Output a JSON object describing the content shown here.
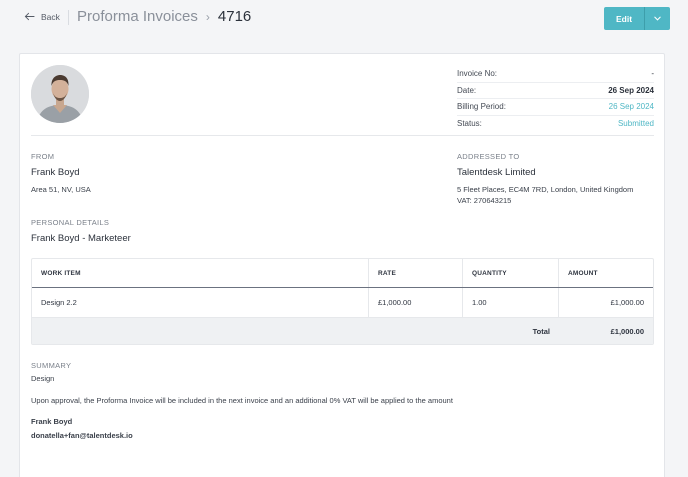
{
  "header": {
    "back_label": "Back",
    "breadcrumb_parent": "Proforma Invoices",
    "breadcrumb_current": "4716",
    "edit_label": "Edit",
    "accent_color": "#4fb7c5"
  },
  "meta": {
    "invoice_no_label": "Invoice No:",
    "invoice_no_value": "-",
    "date_label": "Date:",
    "date_value": "26 Sep 2024",
    "billing_label": "Billing Period:",
    "billing_value": "26 Sep 2024",
    "status_label": "Status:",
    "status_value": "Submitted"
  },
  "from": {
    "heading": "FROM",
    "name": "Frank Boyd",
    "address": "Area 51, NV, USA"
  },
  "addressed": {
    "heading": "ADDRESSED TO",
    "name": "Talentdesk Limited",
    "address": "5 Fleet Places, EC4M 7RD, London, United Kingdom",
    "vat": "VAT: 270643215"
  },
  "personal": {
    "heading": "PERSONAL DETAILS",
    "value": "Frank Boyd - Marketeer"
  },
  "table": {
    "headers": [
      "WORK ITEM",
      "RATE",
      "QUANTITY",
      "AMOUNT"
    ],
    "rows": [
      [
        "Design 2.2",
        "£1,000.00",
        "1.00",
        "£1,000.00"
      ]
    ],
    "total_label": "Total",
    "total_value": "£1,000.00"
  },
  "summary": {
    "heading": "SUMMARY",
    "text": "Design",
    "note": "Upon approval, the Proforma Invoice will be included in the next invoice and an additional 0% VAT will be applied to the amount",
    "signer_name": "Frank Boyd",
    "signer_email": "donatella+fan@talentdesk.io"
  }
}
